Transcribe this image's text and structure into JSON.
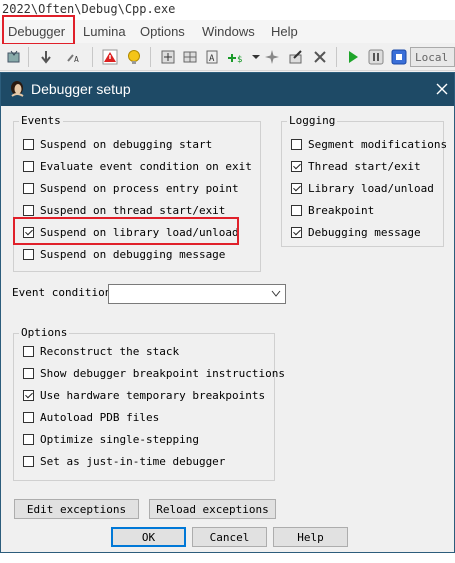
{
  "window": {
    "title": "2022\\Often\\Debug\\Cpp.exe"
  },
  "menu": {
    "items": [
      "Debugger",
      "Lumina",
      "Options",
      "Windows",
      "Help"
    ]
  },
  "toolbar": {
    "debugger_combo": "Local W"
  },
  "dialog": {
    "title": "Debugger setup",
    "events": {
      "label": "Events",
      "items": [
        {
          "label": "Suspend on debugging start",
          "checked": false
        },
        {
          "label": "Evaluate event condition on exit",
          "checked": false
        },
        {
          "label": "Suspend on process entry point",
          "checked": false
        },
        {
          "label": "Suspend on thread start/exit",
          "checked": false
        },
        {
          "label": "Suspend on library load/unload",
          "checked": true
        },
        {
          "label": "Suspend on debugging message",
          "checked": false
        }
      ]
    },
    "logging": {
      "label": "Logging",
      "items": [
        {
          "label": "Segment modifications",
          "checked": false
        },
        {
          "label": "Thread start/exit",
          "checked": true
        },
        {
          "label": "Library load/unload",
          "checked": true
        },
        {
          "label": "Breakpoint",
          "checked": false
        },
        {
          "label": "Debugging message",
          "checked": true
        }
      ]
    },
    "event_condition": {
      "label": "Event condition",
      "value": ""
    },
    "options": {
      "label": "Options",
      "items": [
        {
          "label": "Reconstruct the stack",
          "checked": false
        },
        {
          "label": "Show debugger breakpoint instructions",
          "checked": false
        },
        {
          "label": "Use hardware temporary breakpoints",
          "checked": true
        },
        {
          "label": "Autoload PDB files",
          "checked": false
        },
        {
          "label": "Optimize single-stepping",
          "checked": false
        },
        {
          "label": "Set as just-in-time debugger",
          "checked": false
        }
      ]
    },
    "buttons": {
      "edit_exceptions": "Edit exceptions",
      "reload_exceptions": "Reload exceptions",
      "ok": "OK",
      "cancel": "Cancel",
      "help": "Help"
    }
  },
  "colors": {
    "title_bar": "#1e4a66",
    "highlight": "#e0202a",
    "accent_default": "#0078d7"
  }
}
